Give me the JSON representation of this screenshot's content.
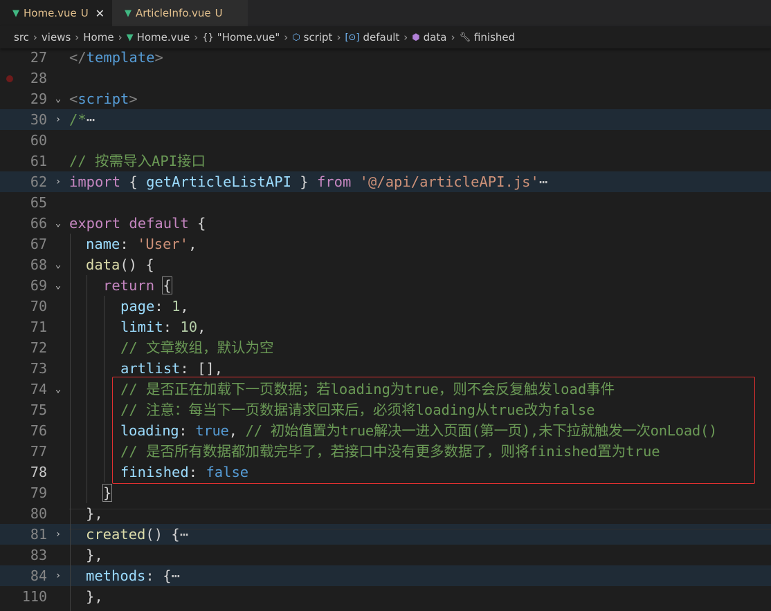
{
  "tabs": [
    {
      "label": "Home.vue",
      "badge": "U",
      "active": true
    },
    {
      "label": "ArticleInfo.vue",
      "badge": "U",
      "active": false
    }
  ],
  "breadcrumb": {
    "src": "src",
    "views": "views",
    "home": "Home",
    "file": "Home.vue",
    "component": "\"Home.vue\"",
    "script": "script",
    "default": "default",
    "data": "data",
    "finished": "finished"
  },
  "lines": {
    "l27": {
      "num": "27",
      "open": "</",
      "tag": "template",
      "close": ">"
    },
    "l28": {
      "num": "28"
    },
    "l29": {
      "num": "29",
      "open": "<",
      "tag": "script",
      "close": ">"
    },
    "l30": {
      "num": "30",
      "comment": "/*",
      "ellipsis": "⋯"
    },
    "l60": {
      "num": "60"
    },
    "l61": {
      "num": "61",
      "comment": "// 按需导入API接口"
    },
    "l62": {
      "num": "62",
      "kw_import": "import",
      "open": " { ",
      "fn": "getArticleListAPI",
      "close": " } ",
      "kw_from": "from",
      "str": "'@/api/articleAPI.js'",
      "ellipsis": "⋯"
    },
    "l65": {
      "num": "65"
    },
    "l66": {
      "num": "66",
      "kw_export": "export",
      "kw_default": "default",
      "brace": "{"
    },
    "l67": {
      "num": "67",
      "prop": "name",
      "colon": ": ",
      "str": "'User'",
      "comma": ","
    },
    "l68": {
      "num": "68",
      "fn": "data",
      "rest": "() {"
    },
    "l69": {
      "num": "69",
      "kw": "return",
      "brace": "{"
    },
    "l70": {
      "num": "70",
      "prop": "page",
      "colon": ": ",
      "val": "1",
      "comma": ","
    },
    "l71": {
      "num": "71",
      "prop": "limit",
      "colon": ": ",
      "val": "10",
      "comma": ","
    },
    "l72": {
      "num": "72",
      "comment": "// 文章数组，默认为空"
    },
    "l73": {
      "num": "73",
      "prop": "artlist",
      "rest": ": [],"
    },
    "l74": {
      "num": "74",
      "comment": "// 是否正在加载下一页数据；若loading为true，则不会反复触发load事件"
    },
    "l75": {
      "num": "75",
      "comment": "// 注意：每当下一页数据请求回来后，必须将loading从true改为false"
    },
    "l76": {
      "num": "76",
      "prop": "loading",
      "colon": ": ",
      "val": "true",
      "comma": ", ",
      "comment": "// 初始值置为true解决一进入页面(第一页),未下拉就触发一次onLoad()"
    },
    "l77": {
      "num": "77",
      "comment": "// 是否所有数据都加载完毕了，若接口中没有更多数据了，则将finished置为true"
    },
    "l78": {
      "num": "78",
      "prop": "finished",
      "colon": ": ",
      "val": "false"
    },
    "l79": {
      "num": "79",
      "brace": "}"
    },
    "l80": {
      "num": "80",
      "rest": "},"
    },
    "l81": {
      "num": "81",
      "fn": "created",
      "rest": "() {",
      "ellipsis": "⋯"
    },
    "l83": {
      "num": "83",
      "rest": "},"
    },
    "l84": {
      "num": "84",
      "prop": "methods",
      "rest": ": {",
      "ellipsis": "⋯"
    },
    "l110": {
      "num": "110",
      "rest": "},"
    }
  },
  "colors": {
    "accent_annotation": "#e03030",
    "vue_green": "#41b883",
    "untracked": "#e2c08d"
  }
}
